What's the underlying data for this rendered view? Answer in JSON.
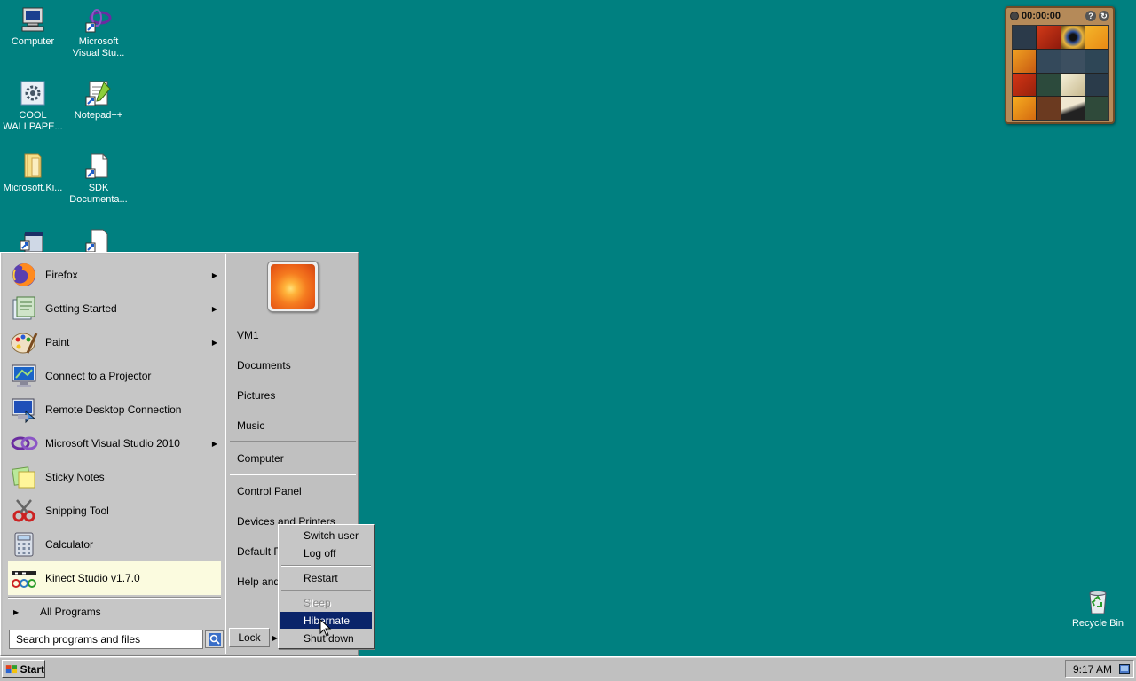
{
  "desktop": {
    "icons": [
      {
        "label": "Computer"
      },
      {
        "label": "Microsoft Visual Stu..."
      },
      {
        "label": "COOL WALLPAPE..."
      },
      {
        "label": "Notepad++"
      },
      {
        "label": "Microsoft.Ki..."
      },
      {
        "label": "SDK Documenta..."
      }
    ],
    "recycle_bin": {
      "label": "Recycle Bin"
    }
  },
  "gadget": {
    "timer": "00:00:00"
  },
  "start_menu": {
    "programs": [
      {
        "label": "Firefox",
        "submenu": true
      },
      {
        "label": "Getting Started",
        "submenu": true
      },
      {
        "label": "Paint",
        "submenu": true
      },
      {
        "label": "Connect to a Projector",
        "submenu": false
      },
      {
        "label": "Remote Desktop Connection",
        "submenu": false
      },
      {
        "label": "Microsoft Visual Studio 2010",
        "submenu": true
      },
      {
        "label": "Sticky Notes",
        "submenu": false
      },
      {
        "label": "Snipping Tool",
        "submenu": false
      },
      {
        "label": "Calculator",
        "submenu": false
      },
      {
        "label": "Kinect Studio v1.7.0",
        "submenu": false,
        "highlighted": true
      }
    ],
    "all_programs": "All Programs",
    "search": {
      "placeholder": "Search programs and files"
    },
    "right_links": [
      "VM1",
      "Documents",
      "Pictures",
      "Music",
      "Computer",
      "Control Panel",
      "Devices and Printers",
      "Default Pr",
      "Help and"
    ],
    "lock_label": "Lock",
    "submenu_arrows": [
      "▶",
      "▶"
    ]
  },
  "power_menu": {
    "items": [
      {
        "label": "Switch user",
        "state": "normal"
      },
      {
        "label": "Log off",
        "state": "normal"
      },
      {
        "label": "Restart",
        "state": "normal"
      },
      {
        "label": "Sleep",
        "state": "disabled"
      },
      {
        "label": "Hibernate",
        "state": "active"
      },
      {
        "label": "Shut down",
        "state": "normal"
      }
    ]
  },
  "taskbar": {
    "start_label": "Start",
    "clock": "9:17 AM"
  },
  "colors": {
    "desktop": "#008080",
    "menu": "#c0c0c0",
    "highlight": "#0a246a",
    "hover_program": "#fbfbdf"
  }
}
